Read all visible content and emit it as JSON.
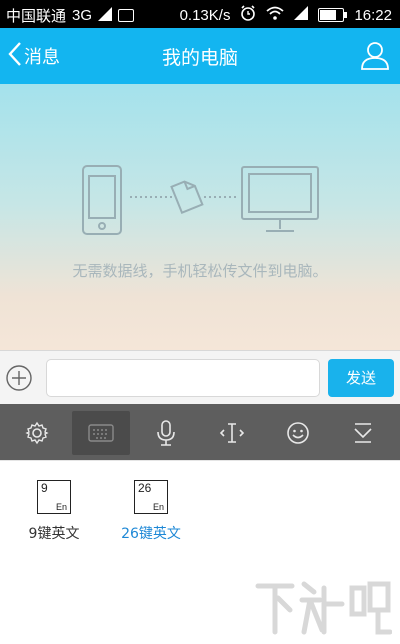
{
  "status_bar": {
    "carrier": "中国联通",
    "network": "3G",
    "speed": "0.13K/s",
    "time": "16:22",
    "battery_level": 0.75,
    "icons": [
      "image-icon",
      "alarm-icon",
      "wifi-icon",
      "signal-icon",
      "battery-icon"
    ]
  },
  "navbar": {
    "back_label": "消息",
    "title": "我的电脑",
    "right_icon": "person-icon"
  },
  "content": {
    "hint": "无需数据线，手机轻松传文件到电脑。"
  },
  "input_bar": {
    "placeholder": "",
    "value": "",
    "send_label": "发送"
  },
  "keyboard_toolbar": {
    "items": [
      {
        "name": "gear-icon",
        "active": false
      },
      {
        "name": "keyboard-icon",
        "active": true
      },
      {
        "name": "mic-icon",
        "active": false
      },
      {
        "name": "text-cursor-icon",
        "active": false
      },
      {
        "name": "smiley-icon",
        "active": false
      },
      {
        "name": "collapse-icon",
        "active": false
      }
    ]
  },
  "keyboard_panel": {
    "options": [
      {
        "icon_number": "9",
        "icon_sub": "En",
        "label": "9键英文",
        "selected": false
      },
      {
        "icon_number": "26",
        "icon_sub": "En",
        "label": "26键英文",
        "selected": true
      }
    ]
  },
  "colors": {
    "nav": "#13b5f0",
    "send": "#19b2ec",
    "toolbar": "#5e5e5e",
    "selected_text": "#1e88d6"
  },
  "watermark": {
    "text": "下载吧"
  }
}
